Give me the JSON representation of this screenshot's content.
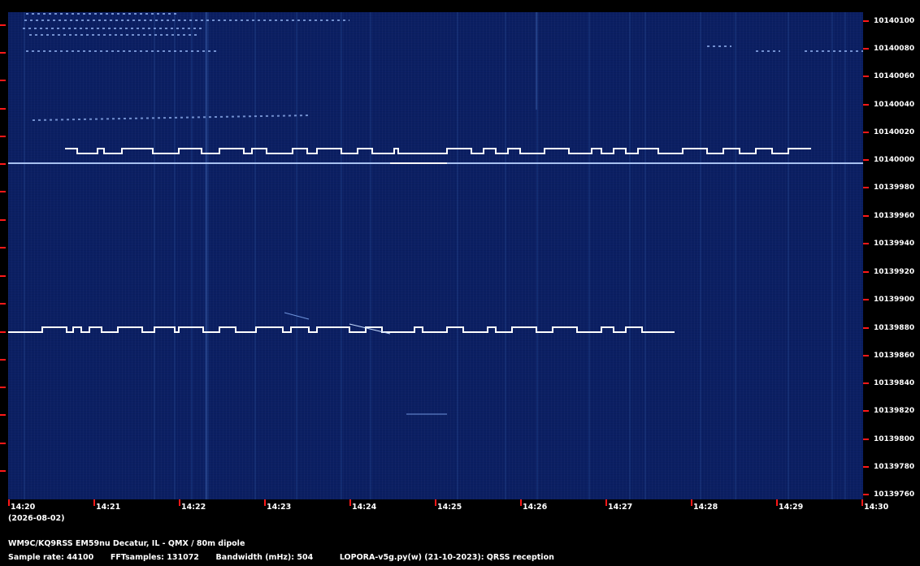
{
  "header": {
    "station": "WM9C/KQ9RSS EM59nu Decatur, IL - QMX / 80m dipole"
  },
  "footer": {
    "sample_rate_label": "Sample rate: 44100",
    "fft_label": "FFTsamples: 131072",
    "bandwidth_label": "Bandwidth (mHz): 504",
    "software_label": "LOPORA-v5g.py(w) (21-10-2023): QRSS reception"
  },
  "date_label": "(2026-08-02)",
  "freq_axis": {
    "labels": [
      "10140100",
      "10140080",
      "10140060",
      "10140040",
      "10140020",
      "10140000",
      "10139980",
      "10139960",
      "10139940",
      "10139920",
      "10139900",
      "10139880",
      "10139860",
      "10139840",
      "10139820",
      "10139800",
      "10139780",
      "10139760"
    ]
  },
  "time_axis": {
    "labels": [
      "14:20",
      "14:21",
      "14:22",
      "14:23",
      "14:24",
      "14:25",
      "14:26",
      "14:27",
      "14:28",
      "14:29",
      "14:30"
    ]
  },
  "colors": {
    "background": "#000000",
    "waterfall_bg": "#0b1f63",
    "tick_color": "#ff1818",
    "signal": "#ffffff",
    "text": "#ffffff"
  }
}
